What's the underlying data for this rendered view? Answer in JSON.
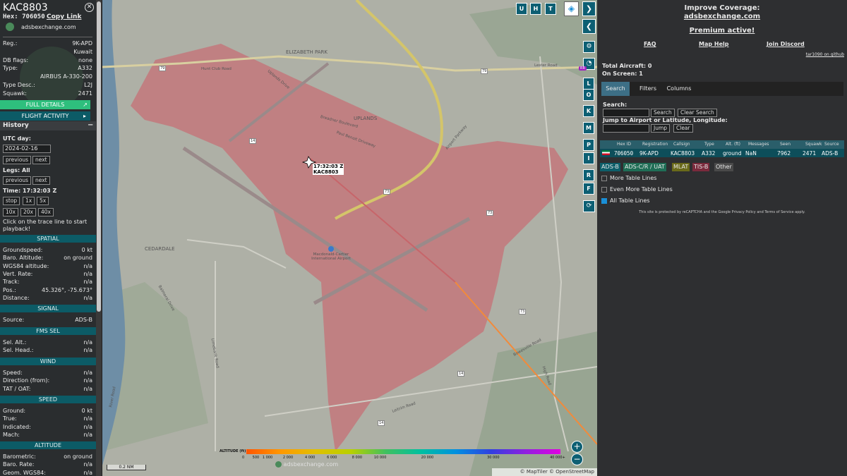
{
  "aircraft": {
    "callsign": "KAC8803",
    "hex_label": "Hex:",
    "hex": "706050",
    "copy_link": "Copy Link",
    "source_site": "adsbexchange.com",
    "details": [
      {
        "k": "Reg.:",
        "v": "9K-APD"
      },
      {
        "k": "",
        "v": "Kuwait"
      },
      {
        "k": "DB flags:",
        "v": "none"
      },
      {
        "k": "Type:",
        "v": "A332"
      },
      {
        "k": "",
        "v": "AIRBUS A-330-200"
      },
      {
        "k": "Type Desc.:",
        "v": "L2J"
      },
      {
        "k": "Squawk:",
        "v": "2471"
      }
    ],
    "full_details": "FULL DETAILS",
    "flight_activity": "FLIGHT ACTIVITY"
  },
  "history": {
    "title": "History",
    "collapse": "−",
    "utc_day_label": "UTC day:",
    "date": "2024-02-16",
    "previous": "previous",
    "next": "next",
    "legs_label": "Legs: All",
    "time_label": "Time: 17:32:03 Z",
    "stop": "stop",
    "speeds": [
      "1x",
      "5x",
      "10x",
      "20x",
      "40x"
    ],
    "hint": "Click on the trace line to start playback!"
  },
  "sections": {
    "spatial": {
      "title": "SPATIAL",
      "rows": [
        {
          "k": "Groundspeed:",
          "v": "0 kt"
        },
        {
          "k": "Baro. Altitude:",
          "v": "on ground"
        },
        {
          "k": "WGS84 altitude:",
          "v": "n/a"
        },
        {
          "k": "Vert. Rate:",
          "v": "n/a"
        },
        {
          "k": "Track:",
          "v": "n/a"
        },
        {
          "k": "Pos.:",
          "v": "45.326°, -75.673°"
        },
        {
          "k": "Distance:",
          "v": "n/a"
        }
      ]
    },
    "signal": {
      "title": "SIGNAL",
      "rows": [
        {
          "k": "Source:",
          "v": "ADS-B"
        }
      ]
    },
    "fms": {
      "title": "FMS SEL",
      "rows": [
        {
          "k": "Sel. Alt.:",
          "v": "n/a"
        },
        {
          "k": "Sel. Head.:",
          "v": "n/a"
        }
      ]
    },
    "wind": {
      "title": "WIND",
      "rows": [
        {
          "k": "Speed:",
          "v": "n/a"
        },
        {
          "k": "Direction (from):",
          "v": "n/a"
        },
        {
          "k": "TAT / OAT:",
          "v": "n/a"
        }
      ]
    },
    "speed": {
      "title": "SPEED",
      "rows": [
        {
          "k": "Ground:",
          "v": "0 kt"
        },
        {
          "k": "True:",
          "v": "n/a"
        },
        {
          "k": "Indicated:",
          "v": "n/a"
        },
        {
          "k": "Mach:",
          "v": "n/a"
        }
      ]
    },
    "altitude": {
      "title": "ALTITUDE",
      "rows": [
        {
          "k": "Barometric:",
          "v": "on ground"
        },
        {
          "k": "Baro. Rate:",
          "v": "n/a"
        },
        {
          "k": "Geom. WGS84:",
          "v": "n/a"
        }
      ]
    }
  },
  "map": {
    "labels": {
      "elizabeth_park": "ELIZABETH PARK",
      "uplands": "UPLANDS",
      "cedardale": "CEDARDALE",
      "airport": "Macdonald-Cartier International Airport",
      "uplands_drive": "Uplands Drive",
      "breadner": "Breadner Boulevard",
      "paul_benoit": "Paul Benoit Driveway",
      "airport_pkwy": "Airport Parkway",
      "limebank": "Limebank Road",
      "leitrim": "Leitrim Road",
      "bowesville": "Bowesville Road",
      "hunt_club": "Hunt Club Road",
      "lester": "Lester Road",
      "high_road": "High Road",
      "balmoral": "Balmoral Drive",
      "river_road": "River Road"
    },
    "route_shields": [
      "79",
      "79",
      "73",
      "73",
      "14",
      "14",
      "14",
      "73"
    ],
    "aircraft_time": "17:32:03 Z",
    "aircraft_call": "KAC8803",
    "buttons": [
      "U",
      "H",
      "T"
    ],
    "side_buttons": [
      "L",
      "O",
      "K",
      "M",
      "P",
      "I",
      "R",
      "F"
    ],
    "zoom_in": "+",
    "zoom_out": "−",
    "scale": "0.2 NM",
    "altitude_legend_label": "ALTITUDE (ft)",
    "altitude_ticks": [
      "0",
      "500",
      "1 000",
      "2 000",
      "4 000",
      "6 000",
      "8 000",
      "10 000",
      "20 000",
      "30 000",
      "40 000+"
    ],
    "watermark": "adsbexchange.com",
    "attribution": "© MapTiler © OpenStreetMap contributors",
    "range_rings_badge": "RR"
  },
  "right": {
    "improve": "Improve Coverage:",
    "site": "adsbexchange.com",
    "premium": "Premium active!",
    "links": [
      "FAQ",
      "Map Help",
      "Join Discord"
    ],
    "github": "tar1090 on github",
    "total_aircraft": "Total Aircraft: 0",
    "on_screen": "On Screen: 1",
    "tabs": [
      "Search",
      "Filters",
      "Columns"
    ],
    "search_label": "Search:",
    "search_button": "Search",
    "clear_search": "Clear Search",
    "jump_label": "Jump to Airport or Latitude, Longitude:",
    "jump_button": "Jump",
    "clear": "Clear",
    "table": {
      "headers": [
        "Hex ID",
        "Registration",
        "Callsign",
        "Type",
        "Alt. (ft)",
        "Messages",
        "Seen",
        "Squawk",
        "Source"
      ],
      "rows": [
        [
          "706050",
          "9K-APD",
          "KAC8803",
          "A332",
          "ground",
          "NaN",
          "7962",
          "2471",
          "ADS-B"
        ]
      ]
    },
    "sources": [
      {
        "label": "ADS-B",
        "color": "#0e5f6a"
      },
      {
        "label": "ADS-C/R / UAT",
        "color": "#1f6e56"
      },
      {
        "label": "MLAT",
        "color": "#6a6a1a"
      },
      {
        "label": "TIS-B",
        "color": "#7a2a3c"
      },
      {
        "label": "Other",
        "color": "#4a4a4a"
      }
    ],
    "options": [
      {
        "label": "More Table Lines",
        "checked": false
      },
      {
        "label": "Even More Table Lines",
        "checked": false
      },
      {
        "label": "All Table Lines",
        "checked": true
      }
    ],
    "recaptcha": "This site is protected by reCAPTCHA and the Google Privacy Policy and Terms of Service apply."
  }
}
